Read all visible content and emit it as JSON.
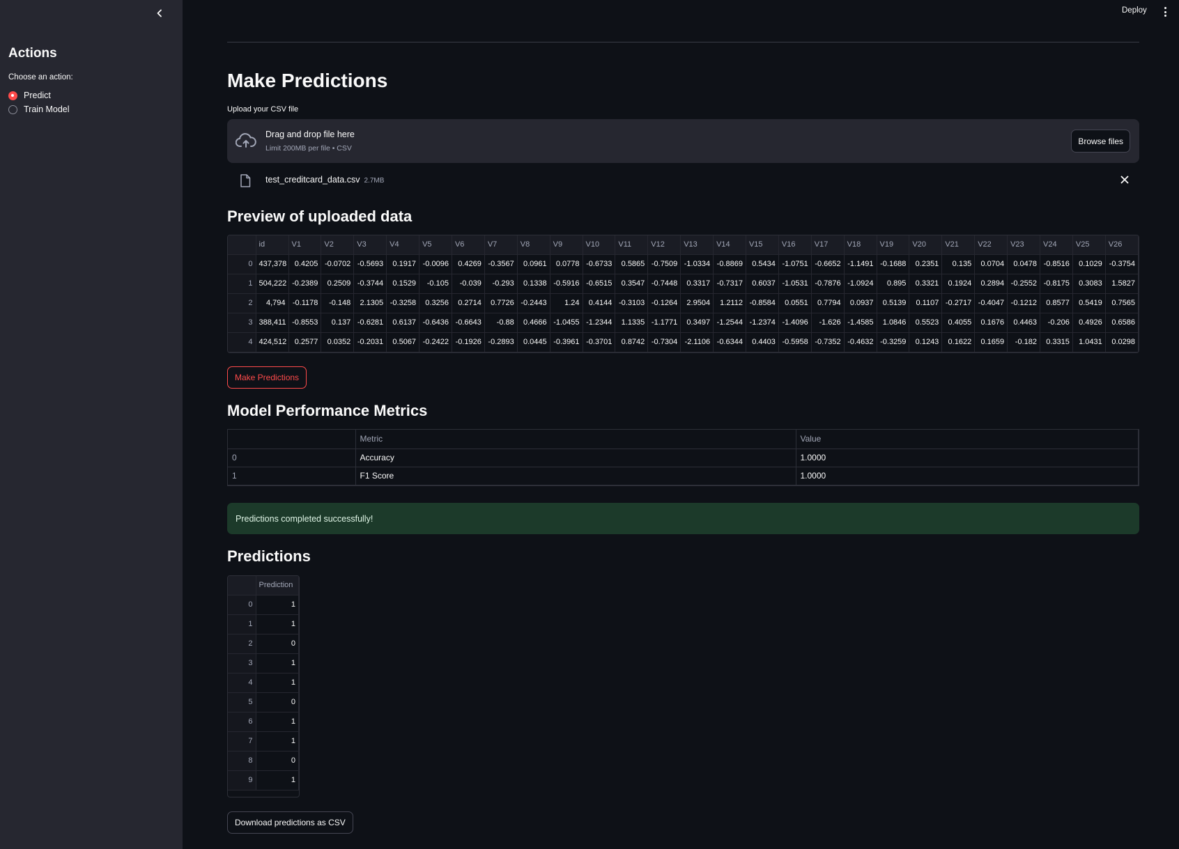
{
  "sidebar": {
    "title": "Actions",
    "label": "Choose an action:",
    "options": [
      {
        "label": "Predict",
        "selected": true
      },
      {
        "label": "Train Model",
        "selected": false
      }
    ]
  },
  "header": {
    "deploy_label": "Deploy"
  },
  "main": {
    "title": "Make Predictions",
    "upload_label": "Upload your CSV file",
    "dropzone": {
      "title": "Drag and drop file here",
      "limit": "Limit 200MB per file • CSV",
      "browse_label": "Browse files"
    },
    "file": {
      "name": "test_creditcard_data.csv",
      "size": "2.7MB"
    },
    "preview_title": "Preview of uploaded data",
    "preview": {
      "columns": [
        "id",
        "V1",
        "V2",
        "V3",
        "V4",
        "V5",
        "V6",
        "V7",
        "V8",
        "V9",
        "V10",
        "V11",
        "V12",
        "V13",
        "V14",
        "V15",
        "V16",
        "V17",
        "V18",
        "V19",
        "V20",
        "V21",
        "V22",
        "V23",
        "V24",
        "V25",
        "V26"
      ],
      "rows": [
        {
          "index": "0",
          "cells": [
            "437,378",
            "0.4205",
            "-0.0702",
            "-0.5693",
            "0.1917",
            "-0.0096",
            "0.4269",
            "-0.3567",
            "0.0961",
            "0.0778",
            "-0.6733",
            "0.5865",
            "-0.7509",
            "-1.0334",
            "-0.8869",
            "0.5434",
            "-1.0751",
            "-0.6652",
            "-1.1491",
            "-0.1688",
            "0.2351",
            "0.135",
            "0.0704",
            "0.0478",
            "-0.8516",
            "0.1029",
            "-0.3754"
          ]
        },
        {
          "index": "1",
          "cells": [
            "504,222",
            "-0.2389",
            "0.2509",
            "-0.3744",
            "0.1529",
            "-0.105",
            "-0.039",
            "-0.293",
            "0.1338",
            "-0.5916",
            "-0.6515",
            "0.3547",
            "-0.7448",
            "0.3317",
            "-0.7317",
            "0.6037",
            "-1.0531",
            "-0.7876",
            "-1.0924",
            "0.895",
            "0.3321",
            "0.1924",
            "0.2894",
            "-0.2552",
            "-0.8175",
            "0.3083",
            "1.5827"
          ]
        },
        {
          "index": "2",
          "cells": [
            "4,794",
            "-0.1178",
            "-0.148",
            "2.1305",
            "-0.3258",
            "0.3256",
            "0.2714",
            "0.7726",
            "-0.2443",
            "1.24",
            "0.4144",
            "-0.3103",
            "-0.1264",
            "2.9504",
            "1.2112",
            "-0.8584",
            "0.0551",
            "0.7794",
            "0.0937",
            "0.5139",
            "0.1107",
            "-0.2717",
            "-0.4047",
            "-0.1212",
            "0.8577",
            "0.5419",
            "0.7565"
          ]
        },
        {
          "index": "3",
          "cells": [
            "388,411",
            "-0.8553",
            "0.137",
            "-0.6281",
            "0.6137",
            "-0.6436",
            "-0.6643",
            "-0.88",
            "0.4666",
            "-1.0455",
            "-1.2344",
            "1.1335",
            "-1.1771",
            "0.3497",
            "-1.2544",
            "-1.2374",
            "-1.4096",
            "-1.626",
            "-1.4585",
            "1.0846",
            "0.5523",
            "0.4055",
            "0.1676",
            "0.4463",
            "-0.206",
            "0.4926",
            "0.6586"
          ]
        },
        {
          "index": "4",
          "cells": [
            "424,512",
            "0.2577",
            "0.0352",
            "-0.2031",
            "0.5067",
            "-0.2422",
            "-0.1926",
            "-0.2893",
            "0.0445",
            "-0.3961",
            "-0.3701",
            "0.8742",
            "-0.7304",
            "-2.1106",
            "-0.6344",
            "0.4403",
            "-0.5958",
            "-0.7352",
            "-0.4632",
            "-0.3259",
            "0.1243",
            "0.1622",
            "0.1659",
            "-0.182",
            "0.3315",
            "1.0431",
            "0.0298"
          ]
        }
      ]
    },
    "make_predictions_button": "Make Predictions",
    "metrics_title": "Model Performance Metrics",
    "metrics": {
      "columns": [
        "",
        "Metric",
        "Value"
      ],
      "rows": [
        {
          "index": "0",
          "metric": "Accuracy",
          "value": "1.0000"
        },
        {
          "index": "1",
          "metric": "F1 Score",
          "value": "1.0000"
        }
      ]
    },
    "success_message": "Predictions completed successfully!",
    "predictions_title": "Predictions",
    "predictions": {
      "column": "Prediction",
      "rows": [
        {
          "index": "0",
          "value": "1"
        },
        {
          "index": "1",
          "value": "1"
        },
        {
          "index": "2",
          "value": "0"
        },
        {
          "index": "3",
          "value": "1"
        },
        {
          "index": "4",
          "value": "1"
        },
        {
          "index": "5",
          "value": "0"
        },
        {
          "index": "6",
          "value": "1"
        },
        {
          "index": "7",
          "value": "1"
        },
        {
          "index": "8",
          "value": "0"
        },
        {
          "index": "9",
          "value": "1"
        }
      ]
    },
    "download_button": "Download predictions as CSV"
  },
  "colors": {
    "background": "#0e1117",
    "sidebar": "#262730",
    "accent": "#ff4b4b",
    "success_bg": "#1c3a2a"
  }
}
